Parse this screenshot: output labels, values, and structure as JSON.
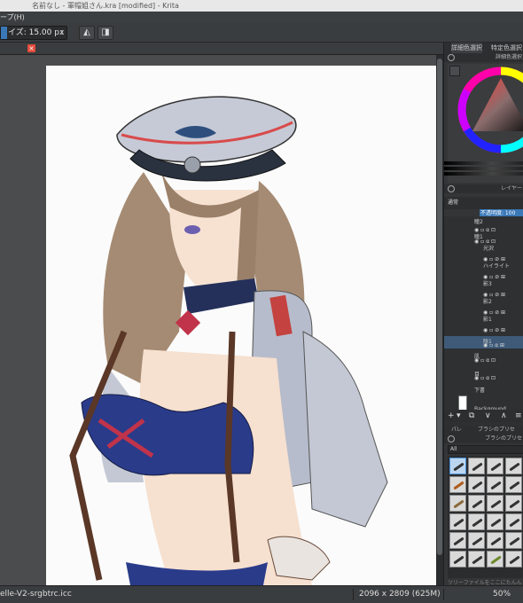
{
  "window": {
    "title": "名前なし - 軍帽姐さん.kra [modified] - Krita"
  },
  "menubar": {
    "visible_item": "ープ(H)"
  },
  "toolbar": {
    "brush_size_label": "イズ: 15.00 px",
    "mirror_h_icon": "mirror-horizontal-icon",
    "mirror_v_icon": "mirror-vertical-icon"
  },
  "document": {
    "tab_close": "×"
  },
  "statusbar": {
    "color_profile": "elle-V2-srgbtrc.icc",
    "image_size": "2096 x 2809 (625M)",
    "zoom": "50%"
  },
  "dock": {
    "color_tabs": [
      "詳細色選択",
      "特定色選択"
    ],
    "color_header": "詳細色選択",
    "layers_title": "レイヤー",
    "blend_mode": "通常",
    "opacity_label": "不透明度: 100",
    "layers": [
      {
        "name": "瞳2",
        "selected": false
      },
      {
        "name": "瞳1",
        "selected": false
      },
      {
        "name": "光沢",
        "selected": false
      },
      {
        "name": "ハイライト",
        "selected": false
      },
      {
        "name": "影3",
        "selected": false
      },
      {
        "name": "影2",
        "selected": false
      },
      {
        "name": "影1",
        "selected": false
      },
      {
        "name": "陰1",
        "selected": true
      },
      {
        "name": "肌",
        "selected": false
      },
      {
        "name": "目",
        "selected": false
      },
      {
        "name": "下書",
        "selected": false
      },
      {
        "name": "Background",
        "selected": false
      }
    ],
    "layer_toolbar": [
      "+",
      "▾",
      "⧉",
      "∨",
      "∧",
      "≡"
    ],
    "brush_tabs": [
      "パレ",
      "ブラシのプリセ"
    ],
    "brush_header": "ブラシのプリセ",
    "brush_filter": "All",
    "brush_tag_hint": "ツリーファイルをここにたんん"
  },
  "colors": {
    "accent": "#3a78b8",
    "close": "#e24b3b",
    "panel": "#333537"
  }
}
